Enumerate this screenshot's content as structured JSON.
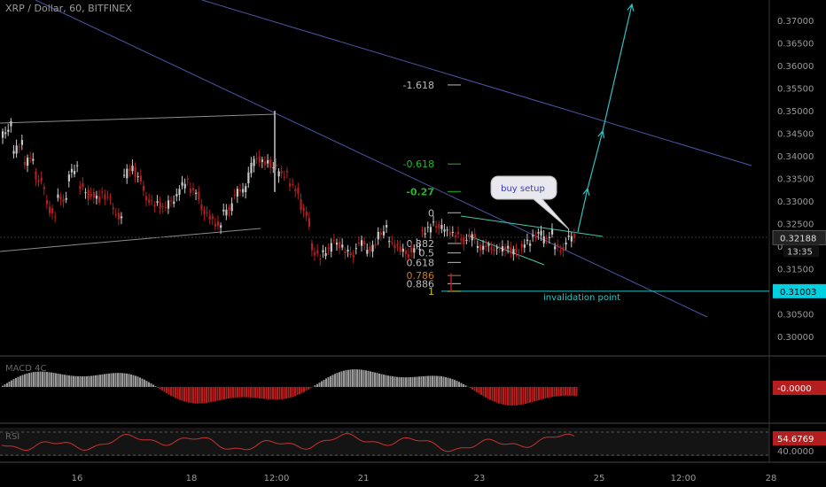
{
  "header": {
    "title": "XRP / Dollar, 60, BITFINEX"
  },
  "colors": {
    "background": "#000000",
    "up": "#c8c8c8",
    "down": "#b41e1e",
    "trendline": "#4a56a6",
    "channel": "#8c8c8c",
    "annotation": "#2ec4c4",
    "fib_gray": "#bbbbbb",
    "fib_green": "#22b822",
    "fib_orange": "#c87a1e",
    "fib_yellow": "#c8c81e"
  },
  "chart_data": [
    {
      "type": "candlestick",
      "title": "XRP / Dollar, 60, BITFINEX",
      "y_ticks": [
        "0.37000",
        "0.36500",
        "0.36000",
        "0.35500",
        "0.35000",
        "0.34500",
        "0.34000",
        "0.33500",
        "0.33000",
        "0.32500",
        "0.32000",
        "0.31500",
        "0.31000",
        "0.30500",
        "0.30000"
      ],
      "ylim": [
        0.297,
        0.373
      ],
      "x_ticks": [
        "16",
        "18",
        "12:00",
        "21",
        "23",
        "25",
        "12:00",
        "28"
      ],
      "last_price": {
        "label": "0.32188",
        "time": "13:35",
        "value": 0.32188
      },
      "invalidation": {
        "label": "0.31003",
        "value": 0.31003,
        "text": "invalidation point"
      },
      "annotations": {
        "buy_setup": "buy setup"
      },
      "fib_levels": [
        {
          "label": "-1.618",
          "value": 0.3557
        },
        {
          "label": "-0.618",
          "value": 0.3382
        },
        {
          "label": "-0.27",
          "value": 0.3321
        },
        {
          "label": "0",
          "value": 0.3274
        },
        {
          "label": "0.382",
          "value": 0.3206
        },
        {
          "label": "0.5",
          "value": 0.3185
        },
        {
          "label": "0.618",
          "value": 0.3164
        },
        {
          "label": "0.786",
          "value": 0.3135
        },
        {
          "label": "0.886",
          "value": 0.3117
        },
        {
          "label": "1",
          "value": 0.31
        }
      ],
      "price_path": [
        [
          0.344,
          0.347
        ],
        [
          0.34,
          0.3435
        ],
        [
          0.338,
          0.34
        ],
        [
          0.336,
          0.333
        ],
        [
          0.33,
          0.326
        ],
        [
          0.331,
          0.33
        ],
        [
          0.335,
          0.338
        ],
        [
          0.334,
          0.331
        ],
        [
          0.332,
          0.33
        ],
        [
          0.332,
          0.33
        ],
        [
          0.328,
          0.326
        ],
        [
          0.335,
          0.338
        ],
        [
          0.337,
          0.333
        ],
        [
          0.331,
          0.329
        ],
        [
          0.33,
          0.328
        ],
        [
          0.329,
          0.331
        ],
        [
          0.332,
          0.335
        ],
        [
          0.333,
          0.331
        ],
        [
          0.329,
          0.326
        ],
        [
          0.326,
          0.324
        ],
        [
          0.327,
          0.329
        ],
        [
          0.331,
          0.333
        ],
        [
          0.332,
          0.34
        ],
        [
          0.34,
          0.338
        ],
        [
          0.339,
          0.337
        ],
        [
          0.336,
          0.336
        ],
        [
          0.334,
          0.332
        ],
        [
          0.33,
          0.325
        ],
        [
          0.32,
          0.317
        ],
        [
          0.318,
          0.32
        ],
        [
          0.321,
          0.32
        ],
        [
          0.319,
          0.318
        ],
        [
          0.32,
          0.321
        ],
        [
          0.319,
          0.32
        ],
        [
          0.322,
          0.324
        ],
        [
          0.321,
          0.32
        ],
        [
          0.3195,
          0.318
        ],
        [
          0.319,
          0.32
        ],
        [
          0.323,
          0.324
        ],
        [
          0.325,
          0.324
        ],
        [
          0.3235,
          0.323
        ],
        [
          0.323,
          0.321
        ],
        [
          0.322,
          0.322
        ],
        [
          0.32,
          0.3195
        ],
        [
          0.32,
          0.319
        ],
        [
          0.319,
          0.32
        ],
        [
          0.319,
          0.3185
        ],
        [
          0.32,
          0.321
        ],
        [
          0.322,
          0.323
        ],
        [
          0.321,
          0.323
        ],
        [
          0.32,
          0.319
        ],
        [
          0.321,
          0.3225
        ]
      ],
      "indicators": [
        {
          "name": "MACD 4C",
          "value": "-0.0000"
        },
        {
          "name": "RSI",
          "value": "54.6769",
          "level": "40.0000"
        }
      ]
    }
  ]
}
